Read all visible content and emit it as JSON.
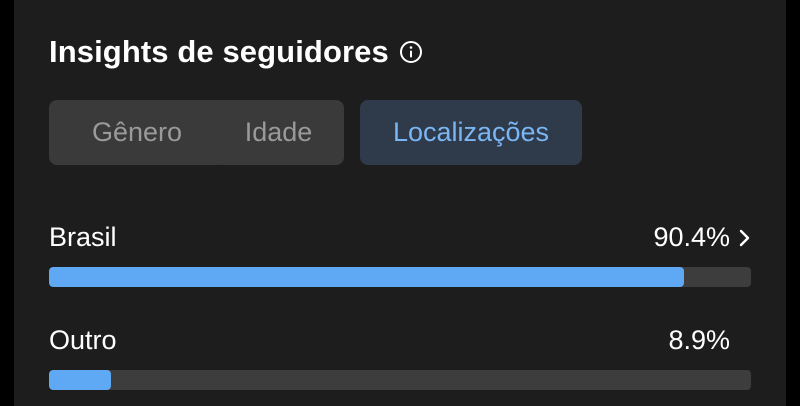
{
  "card": {
    "title": "Insights de seguidores",
    "info_icon": "info-icon"
  },
  "tabs": [
    {
      "label": "Gênero",
      "selected": false
    },
    {
      "label": "Idade",
      "selected": false
    },
    {
      "label": "Localizações",
      "selected": true
    }
  ],
  "locations": [
    {
      "label": "Brasil",
      "value_text": "90.4%",
      "fraction": 0.904,
      "has_chevron": true
    },
    {
      "label": "Outro",
      "value_text": "8.9%",
      "fraction": 0.089,
      "has_chevron": false
    }
  ],
  "colors": {
    "background": "#1d1d1d",
    "tab_bg": "#3a3a3a",
    "tab_text": "#9a9a9a",
    "tab_selected_bg": "#2f3b4b",
    "tab_selected_text": "#7ab6f3",
    "bar_track": "#3d3d3d",
    "bar_fill": "#5fa8f3"
  },
  "icons": {
    "chevron": "chevron-right-icon"
  }
}
